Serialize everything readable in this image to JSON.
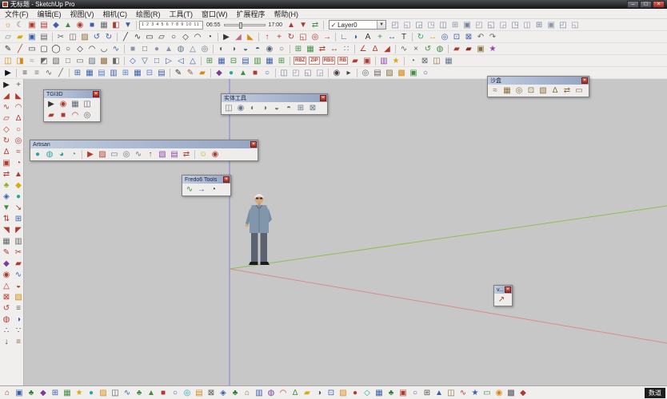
{
  "window": {
    "title": "无标题 - SketchUp Pro",
    "minimize_glyph": "–",
    "maximize_glyph": "□",
    "close_glyph": "×"
  },
  "menu": {
    "items": [
      "文件(F)",
      "编辑(E)",
      "视图(V)",
      "相机(C)",
      "绘图(R)",
      "工具(T)",
      "窗口(W)",
      "扩展程序",
      "帮助(H)"
    ]
  },
  "shadow": {
    "months": "1 2 3 4 5 6 7 8 9 10 11 12",
    "time_from": "06:55",
    "time_to": "17:00"
  },
  "layer": {
    "check_glyph": "✓",
    "selected": "Layer0",
    "arrow_glyph": "▼"
  },
  "bottom_right_label": "数道",
  "toolbars": {
    "row1_left": [
      "shadow-toggle|☼|#d68910",
      "shadow-settings|☾|#666666",
      "red-plugin-1|▣|#b03a2e",
      "red-plugin-2|▤|#b03a2e",
      "blue-plugin-1|◆|#3a5fa8",
      "green-plugin-1|▲|#3f8f3f",
      "red-plugin-3|◉|#b03a2e",
      "blue-plugin-2|■|#3a5fa8",
      "gray-plugin-1|▦|#666666",
      "red-plugin-4|◧|#b03a2e",
      "blue-plugin-3|▼|#3a5fa8",
      "sep"
    ],
    "row1_mid": [
      "date-spin-up|▲|#b03a2e",
      "date-spin-down|▼|#b03a2e",
      "axes-swap|⇄|#3f8f3f",
      "sep"
    ],
    "row1_right": [
      "comp-box-1|◰|#76839b",
      "comp-box-2|◱|#8b97ab",
      "comp-box-3|◲|#76839b",
      "comp-box-4|◳|#8b97ab",
      "comp-box-5|◫|#76839b",
      "comp-box-6|⊞|#8b97ab",
      "comp-box-7|▣|#76839b",
      "comp-box-8|◰|#8b97ab",
      "comp-box-9|◱|#76839b",
      "comp-box-10|◲|#8b97ab",
      "comp-box-11|◳|#76839b",
      "comp-box-12|◫|#8b97ab",
      "comp-box-13|⊞|#76839b",
      "comp-box-14|▣|#8b97ab",
      "comp-box-15|◰|#76839b",
      "comp-box-16|◱|#8b97ab"
    ],
    "row2": [
      "new-file|▱|#888888",
      "open-folder|▰|#d4ac0d",
      "save|▣|#3a5fa8",
      "print|▤|#666666",
      "sep",
      "cut|✂|#666666",
      "copy|◫|#666666",
      "paste|▨|#8a6d3b",
      "undo|↺|#3a5fa8",
      "redo|↻|#3a5fa8",
      "sep",
      "line-tool|╱|#333333",
      "freehand-tool|∿|#333333",
      "rectangle-tool|▭|#333333",
      "rotated-rectangle-tool|▱|#333333",
      "circle-tool|○|#333333",
      "polygon-tool|◇|#333333",
      "arc-tool|◠|#333333",
      "pie-tool|◔|#333333",
      "sep",
      "select-tool|▶|#333333",
      "eraser-tool|◢|#c06a8a",
      "paint-bucket-tool|◣|#d68910",
      "sep",
      "push-pull-tool|↑|#b03a2e",
      "move-tool|+|#b03a2e",
      "rotate-tool|↻|#b03a2e",
      "scale-tool|◱|#b03a2e",
      "offset-tool|◎|#b03a2e",
      "follow-me-tool|→|#b03a2e",
      "sep",
      "tape-measure-tool|∟|#3a5fa8",
      "protractor-tool|◗|#3a5fa8",
      "text-tool|A|#333333",
      "axes-tool|+|#3f8f3f",
      "dimension-tool|↔|#3a5fa8",
      "3d-text-tool|T|#333333",
      "sep",
      "orbit-tool|↻|#27ae60",
      "pan-tool|↔|#d4ac0d",
      "zoom-tool|◎|#3a5fa8",
      "zoom-window-tool|⊡|#3a5fa8",
      "zoom-extents-tool|⊠|#3a5fa8",
      "previous-view|↶|#666666",
      "next-view|↷|#666666"
    ],
    "row3": [
      "pencil-tool|✎|#333333",
      "line-red|╱|#b03a2e",
      "rect-outline|▭|#333333",
      "rounded-rect|▢|#333333",
      "ellipse-tool|◯|#333333",
      "circle-2|○|#333333",
      "polygon-2|◇|#333333",
      "arc-2|◠|#333333",
      "arc-3|◡|#333333",
      "bezier-tool|∿|#3a5fa8",
      "sep",
      "box-solid|■|#8a94a8",
      "box-wire|□|#556677",
      "cylinder|●|#8a94a8",
      "cone|▲|#8a94a8",
      "sphere|◍|#667788",
      "pyramid|△|#667788",
      "torus|◎|#667788",
      "sep",
      "solid-union|◐|#556677",
      "solid-subtract|◑|#556677",
      "solid-trim|◒|#556677",
      "solid-split|◓|#556677",
      "solid-intersect|◉|#556677",
      "solid-shell|○|#556677",
      "sep",
      "grid-tool|⊞|#3f8f3f",
      "mesh-tool|▦|#3f8f3f",
      "flip-tool|⇄|#b03a2e",
      "mirror-tool|↔|#b03a2e",
      "array-tool|∷|#3a5fa8",
      "sep",
      "angle-tool|∠|#b03a2e",
      "triangle-tool|∆|#b03a2e",
      "slope-tool|◢|#b03a2e",
      "sep",
      "weld-tool|∿|#666666",
      "explode-tool|×|#666666",
      "purge-tool|↺|#3f8f3f",
      "cleanup-tool|◍|#3f8f3f",
      "sep",
      "red-folder-1|▰|#b03a2e",
      "red-folder-2|▰|#8a2a1e",
      "package-tool|▣|#8a6d3b",
      "star-plugin|★|#8e44ad"
    ],
    "row4_left": [
      "section-plane|◫|#d68910",
      "section-fill|◨|#d68910",
      "fog-toggle|≈|#8899aa",
      "shadows-toggle|◩|#666666",
      "xray-mode|▧|#666666",
      "wireframe-mode|□|#666666",
      "hidden-line-mode|▭|#666666",
      "shaded-mode|▨|#667788",
      "textured-mode|▩|#8a6d3b",
      "monochrome-mode|◧|#666666",
      "sep",
      "iso-view|◇|#3a5fa8",
      "top-view|▽|#3a5fa8",
      "front-view|□|#3a5fa8",
      "right-view|▷|#3a5fa8",
      "left-view|◁|#3a5fa8",
      "back-view|△|#3a5fa8",
      "sep",
      "grid-1|⊞|#3f8f3f",
      "grid-2|▦|#3a5fa8",
      "grid-3|⊟|#3f8f3f",
      "grid-4|▤|#3a5fa8",
      "grid-5|▥|#3f8f3f",
      "grid-6|▦|#3a5fa8",
      "grid-7|⊞|#3f8f3f",
      "sep"
    ],
    "plugin_chips": [
      "RBZ",
      "ZIP",
      "RBS",
      "RB"
    ],
    "row4_right": [
      "open-rbz|▰|#b03a2e",
      "install-extension|▣|#b03a2e",
      "sep",
      "ruby-console|▥|#8e44ad",
      "plugin-store|★|#d4ac0d",
      "sep",
      "misc-1|◔|#666666",
      "misc-2|⊠|#666666",
      "misc-3|◫|#8a6d3b",
      "misc-4|▦|#667788"
    ],
    "row5": [
      "select-arrow|▶|#111111",
      "sep",
      "edge-style-1|≡|#444444",
      "edge-style-2|≡|#777777",
      "edge-style-3|∿|#666666",
      "edge-style-4|╱|#666666",
      "sep",
      "table-1|⊞|#3a5fa8",
      "table-2|▦|#3a5fa8",
      "table-3|▤|#5a7fc8",
      "table-4|▥|#3a5fa8",
      "table-5|⊞|#5a7fc8",
      "table-6|▦|#3a5fa8",
      "table-7|⊟|#5a7fc8",
      "table-8|▤|#3a5fa8",
      "sep",
      "sketchy-pencil|✎|#333333",
      "marker-pen|✎|#8a6d3b",
      "brush-tool|▰|#d68910",
      "sep",
      "purple-plugin|◆|#7d3c98",
      "teal-plugin|●|#2aa5a0",
      "green-plugin|▲|#3f8f3f",
      "red-plugin|■|#b03a2e",
      "blue-plugin|○|#3a5fa8",
      "sep",
      "comp-1|◫|#76839b",
      "comp-2|◰|#8b97ab",
      "comp-3|◱|#76839b",
      "comp-4|◲|#8b97ab",
      "sep",
      "camera-icon|◉|#444444",
      "video-icon|▸|#444444",
      "sep",
      "gear-1|◎|#666666",
      "layers-icon|▤|#666666",
      "style-icon|▨|#8a6d3b",
      "material-icon|▩|#d68910",
      "scene-icon|▣|#3f8f3f",
      "info-icon|○|#3a5fa8"
    ]
  },
  "left_toolbar": [
    "select-tool|▶|#222222",
    "pan-hand|+|#555555",
    "curve-a|◢|#b03a2e",
    "curve-b|◣|#b03a2e",
    "wave-tool|∿|#b03a2e",
    "arc-red|◠|#b03a2e",
    "quad-tool|▱|#b03a2e",
    "tri-red|∆|#b03a2e",
    "diamond-red|◇|#b03a2e",
    "circle-red|○|#b03a2e",
    "spiral-tool|↻|#b03a2e",
    "offset-red|◎|#b03a2e",
    "delta-red|∆|#b03a2e",
    "ripple-red|≈|#b03a2e",
    "panel-red|▣|#b03a2e",
    "clock-red|◔|#b03a2e",
    "swap-red|⇄|#b03a2e",
    "tri-solid-red|▲|#b03a2e",
    "leaf-tool|♣|#9aab2e",
    "yellow-tool|◆|#d4ac0d",
    "blue-gem|◈|#3a5fa8",
    "teal-dot|●|#2aa5a0",
    "green-down|▼|#3f8f3f",
    "red-arrow|↘|#b03a2e",
    "updown-red|⇅|#b03a2e",
    "blue-grid|⊞|#3a5fa8",
    "corner-a|◥|#b03a2e",
    "corner-b|◤|#b03a2e",
    "gray-mesh|▦|#666666",
    "gray-cols|▥|#666666",
    "pen-red|✎|#b03a2e",
    "scissors-red|✂|#b03a2e",
    "purple-gem|◆|#7d3c98",
    "bar-red|▰|#b03a2e",
    "target-red|◉|#b03a2e",
    "wave-blue|∿|#3a5fa8",
    "tri-out-red|△|#b03a2e",
    "half-red|◒|#b03a2e",
    "boxx-red|⊠|#b03a2e",
    "hatch-orange|▨|#d68910",
    "undo-red|↺|#b03a2e",
    "lines-gray|≡|#666666",
    "dot-red|◍|#b03a2e",
    "half-blue|◑|#3a5fa8",
    "footprints-icon|∴|#333333",
    "footprints-2-icon|∵|#333333",
    "walk-down|↓|#333333",
    "stairs-icon|≡|#8a6d3b"
  ],
  "bottom_toolbar": [
    "house-red|⌂|#b03a2e",
    "grid-blue|▣|#3a5fa8",
    "tree-green|♣|#2e7d32",
    "diamond-purple|◆|#7d3c98",
    "table-blue|⊞|#3a5fa8",
    "mesh-green|▦|#3f8f3f",
    "star-yellow|★|#d4ac0d",
    "dot-teal|●|#2aa5a0",
    "hatch-orange|▨|#d68910",
    "box-gray|◫|#555555",
    "wave-blue|∿|#3a5fa8",
    "tree-green-2|♣|#3f8f3f",
    "tri-green|▲|#3f8f3f",
    "sq-red|■|#b03a2e",
    "circle-blue|○|#3a5fa8",
    "target-teal|◎|#2aa5a0",
    "rows-orange|▤|#d68910",
    "box-x-gray|⊠|#555555",
    "diamond-blue|◈|#3a5fa8",
    "tree-green-3|♣|#2e7d32",
    "house-tan|⌂|#8a6d3b",
    "cols-blue|▥|#3a5fa8",
    "circle-purple|◍|#7d3c98",
    "arc-red|◠|#b03a2e",
    "tri-outline-green|∆|#3f8f3f",
    "bar-yellow|▰|#d4ac0d",
    "half-gray|◑|#555555",
    "sq-dot-blue|⊡|#3a5fa8",
    "hatch-orange-2|▧|#d68910",
    "dot-red|●|#b03a2e",
    "diamond-teal|◇|#2aa5a0",
    "mesh-blue|▦|#3a5fa8",
    "tree-green-4|♣|#2e7d32",
    "grid-red|▣|#b03a2e",
    "circle-outline-purple|○|#7d3c98",
    "plus-box-gray|⊞|#555555",
    "tri-blue|▲|#3a5fa8",
    "box-tan|◫|#8a6d3b",
    "wave-red|∿|#b03a2e",
    "star-blue|★|#3a5fa8",
    "rect-green|▭|#3f8f3f",
    "target-orange|◉|#d68910",
    "shade-gray|▩|#555555",
    "diamond-red|◆|#b03a2e"
  ],
  "floating": {
    "close_glyph": "×",
    "tgi3d": {
      "title": "TGI3D",
      "icons": [
        "tgi3d-select|▶|#333333",
        "tgi3d-calibrate|◉|#b03a2e",
        "tgi3d-mesh|▦|#556677",
        "tgi3d-camera|◫|#556677",
        "tgi3d-book|▰|#b03a2e",
        "tgi3d-box|■|#b03a2e",
        "tgi3d-arc|◠|#b03a2e",
        "tgi3d-settings|◎|#666666"
      ]
    },
    "solid": {
      "title": "实体工具",
      "icons": [
        "outer-shell|◫|#667788",
        "intersect|◉|#667788",
        "union|◐|#667788",
        "subtract|◑|#667788",
        "trim|◒|#667788",
        "split|◓|#667788",
        "solid-a|⊞|#667788",
        "solid-b|⊠|#667788"
      ]
    },
    "artisan": {
      "title": "Artisan",
      "icons": [
        "artisan-subdivide|●|#2aa5a0",
        "artisan-smooth|◍|#2aa5a0",
        "artisan-sculpt|◕|#2aa5a0",
        "artisan-pinch|◔|#2aa5a0",
        "sep",
        "artisan-select|▶|#b03a2e",
        "artisan-paint|▨|#b03a2e",
        "artisan-flatten|▭|#667788",
        "artisan-inflate|◎|#667788",
        "artisan-smudge|∿|#667788",
        "artisan-pull|↑|#b03a2e",
        "artisan-mask|▧|#8e44ad",
        "artisan-unmask|▤|#8e44ad",
        "artisan-mirror|⇄|#b03a2e",
        "sep",
        "artisan-help|☺|#d4ac0d",
        "artisan-info|◉|#b03a2e"
      ]
    },
    "fredo6": {
      "title": "Fredo6 Tools",
      "icons": [
        "fredo6-bezier|∿|#3f8f3f",
        "fredo6-move|→|#3a5fa8",
        "fredo6-timer|◔|#444444"
      ]
    },
    "sandbox": {
      "title": "沙盒",
      "icons": [
        "from-contours|≈|#8a6d3b",
        "from-scratch|▦|#8a6d3b",
        "smoove|◎|#8a6d3b",
        "stamp|⊡|#8a6d3b",
        "drape|▧|#8a6d3b",
        "add-detail|∆|#8a6d3b",
        "flip-edge|⇄|#8a6d3b",
        "sandbox-toggle|▭|#8a6d3b"
      ]
    },
    "mini": {
      "title": "v...",
      "icons": [
        "mini-red-arrow|↗|#b03a2e"
      ]
    }
  }
}
